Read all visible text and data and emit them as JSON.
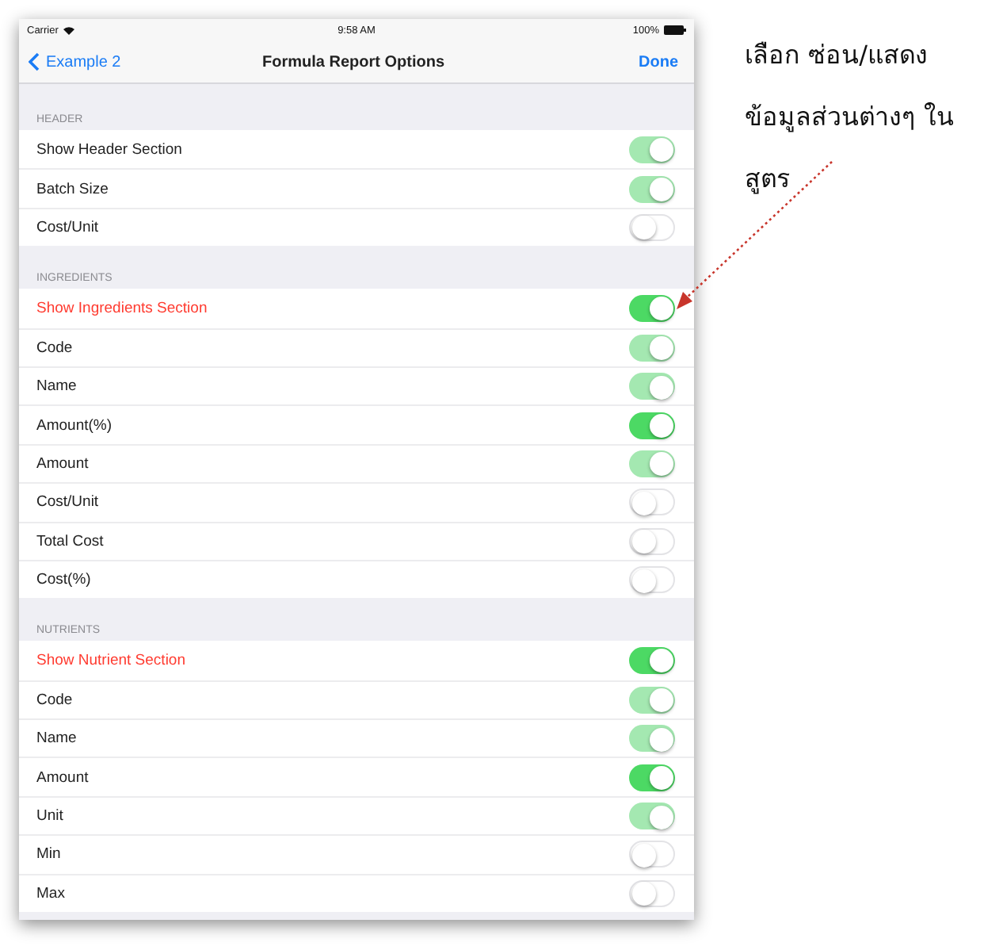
{
  "status_bar": {
    "carrier": "Carrier",
    "time": "9:58 AM",
    "battery": "100%"
  },
  "nav_bar": {
    "back": "Example 2",
    "title": "Formula Report Options",
    "done": "Done"
  },
  "sections": [
    {
      "title": "HEADER",
      "rows": [
        {
          "label": "Show Header Section",
          "kind": "option",
          "on": true,
          "disabled": true
        },
        {
          "label": "Batch Size",
          "kind": "option",
          "on": true,
          "disabled": true
        },
        {
          "label": "Cost/Unit",
          "kind": "option",
          "on": false,
          "disabled": false
        }
      ]
    },
    {
      "title": "INGREDIENTS",
      "rows": [
        {
          "label": "Show Ingredients Section",
          "kind": "master",
          "on": true,
          "disabled": false
        },
        {
          "label": "Code",
          "kind": "option",
          "on": true,
          "disabled": true
        },
        {
          "label": "Name",
          "kind": "option",
          "on": true,
          "disabled": true
        },
        {
          "label": "Amount(%)",
          "kind": "option",
          "on": true,
          "disabled": false
        },
        {
          "label": "Amount",
          "kind": "option",
          "on": true,
          "disabled": true
        },
        {
          "label": "Cost/Unit",
          "kind": "option",
          "on": false,
          "disabled": false
        },
        {
          "label": "Total Cost",
          "kind": "option",
          "on": false,
          "disabled": false
        },
        {
          "label": "Cost(%)",
          "kind": "option",
          "on": false,
          "disabled": false
        }
      ]
    },
    {
      "title": "NUTRIENTS",
      "rows": [
        {
          "label": "Show Nutrient Section",
          "kind": "master",
          "on": true,
          "disabled": false
        },
        {
          "label": "Code",
          "kind": "option",
          "on": true,
          "disabled": true
        },
        {
          "label": "Name",
          "kind": "option",
          "on": true,
          "disabled": true
        },
        {
          "label": "Amount",
          "kind": "option",
          "on": true,
          "disabled": false
        },
        {
          "label": "Unit",
          "kind": "option",
          "on": true,
          "disabled": true
        },
        {
          "label": "Min",
          "kind": "option",
          "on": false,
          "disabled": false
        },
        {
          "label": "Max",
          "kind": "option",
          "on": false,
          "disabled": false
        }
      ]
    }
  ],
  "annotation": {
    "lines": [
      "เลือก ซ่อน/แสดง",
      "ข้อมูลส่วนต่างๆ ใน",
      "สูตร"
    ]
  }
}
